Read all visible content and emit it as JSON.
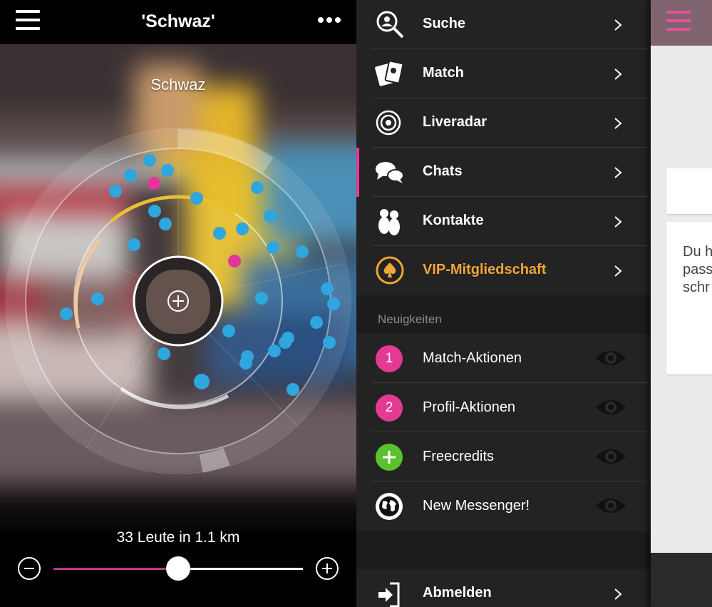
{
  "radar_screen": {
    "title": "'Schwaz'",
    "place_label": "Schwaz",
    "people_count": "33 Leute in 1.1 km",
    "zoom_level": 0.5,
    "accent_color": "#c2348f"
  },
  "menu": {
    "items": [
      {
        "label": "Suche",
        "icon": "search-icon"
      },
      {
        "label": "Match",
        "icon": "cards-icon"
      },
      {
        "label": "Liveradar",
        "icon": "radar-icon"
      },
      {
        "label": "Chats",
        "icon": "chat-bubbles-icon"
      },
      {
        "label": "Kontakte",
        "icon": "contacts-icon"
      },
      {
        "label": "VIP-Mitgliedschaft",
        "icon": "spade-icon"
      }
    ],
    "active_item": "Chats",
    "active_color": "#e43a93",
    "vip_color": "#f0a43a",
    "news_header": "Neuigkeiten",
    "news": [
      {
        "label": "Match-Aktionen",
        "badge": "1",
        "badge_color": "#e43a93"
      },
      {
        "label": "Profil-Aktionen",
        "badge": "2",
        "badge_color": "#e43a93"
      },
      {
        "label": "Freecredits",
        "badge": "+",
        "badge_color": "#5cc12e"
      },
      {
        "label": "New Messenger!",
        "badge": "globe-icon",
        "badge_color": "#ffffff"
      }
    ],
    "logout_label": "Abmelden"
  },
  "right_pane": {
    "card_text": "Du h\npass\nschr"
  }
}
